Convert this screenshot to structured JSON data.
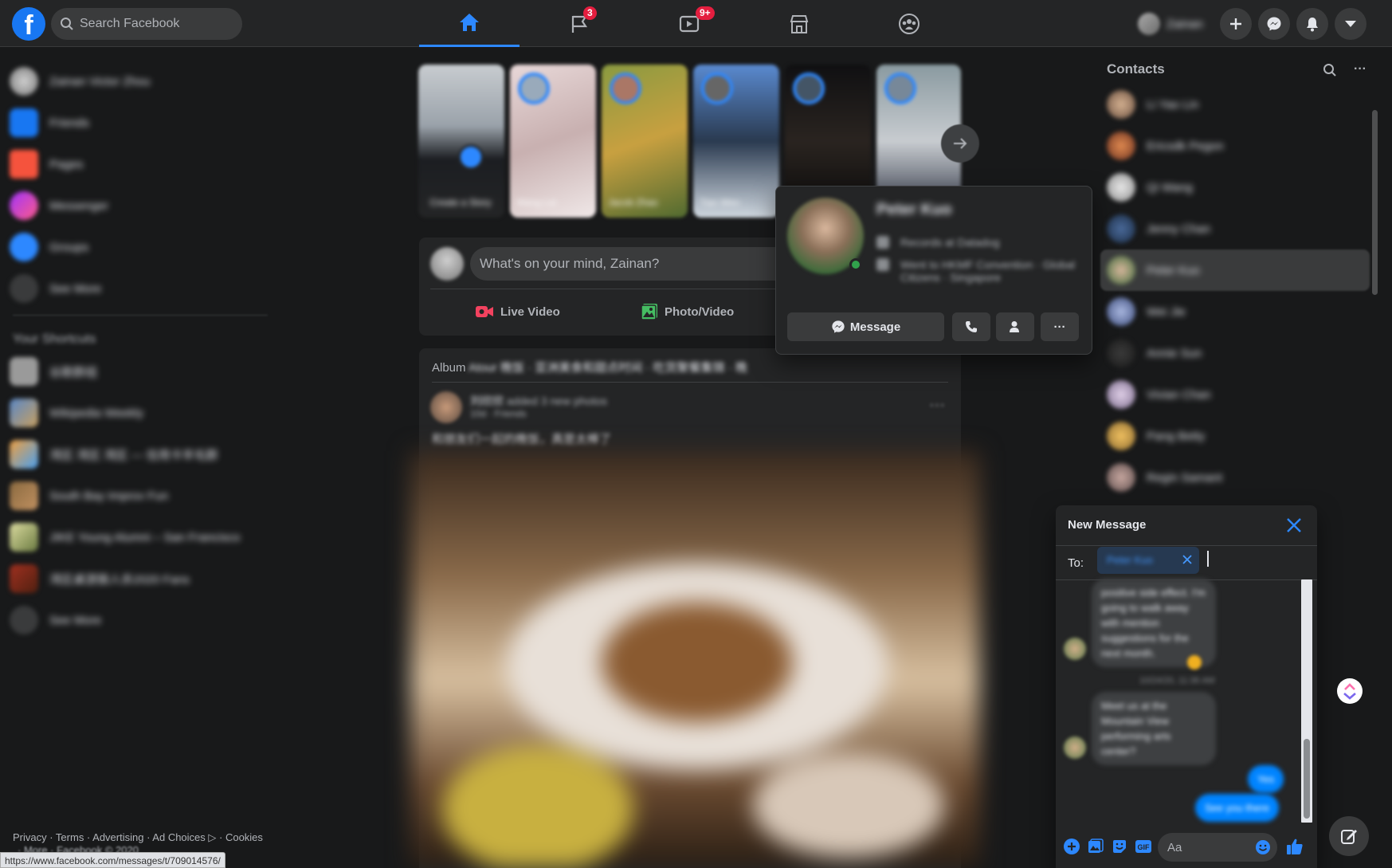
{
  "colors": {
    "accent": "#2d88ff",
    "badge": "#e41e3f",
    "online": "#31a24c",
    "live_video": "#f3425f",
    "photo": "#45bd62"
  },
  "search": {
    "placeholder": "Search Facebook"
  },
  "nav": {
    "tabs": [
      {
        "icon": "home-icon",
        "active": true
      },
      {
        "icon": "pages-flag-icon",
        "badge": "3"
      },
      {
        "icon": "watch-icon",
        "badge": "9+"
      },
      {
        "icon": "marketplace-icon"
      },
      {
        "icon": "groups-icon"
      }
    ]
  },
  "header": {
    "profile_name": "Zainan"
  },
  "left_menu": {
    "items": [
      {
        "label": "Zainan Victor Zhou"
      },
      {
        "label": "Friends"
      },
      {
        "label": "Pages"
      },
      {
        "label": "Messenger"
      },
      {
        "label": "Groups"
      },
      {
        "label": "See More"
      }
    ],
    "shortcuts_heading": "Your Shortcuts",
    "shortcuts": [
      {
        "label": "谷歌群组"
      },
      {
        "label": "Wikipedia Weekly"
      },
      {
        "label": "湾区 湾区 湾区 — 信用卡羊毛群"
      },
      {
        "label": "South Bay Improv Fun"
      },
      {
        "label": "JIKE Young Alumni – San Francisco"
      },
      {
        "label": "湾区桌游狼人杀2020 Fans"
      },
      {
        "label": "See More"
      }
    ]
  },
  "footer": {
    "links": "Privacy · Terms · Advertising · Ad Choices ▷ · Cookies",
    "line2": "· More · Facebook © 2020",
    "status_url": "https://www.facebook.com/messages/t/709014576/"
  },
  "stories": [
    {
      "caption": "Create a Story"
    },
    {
      "caption": "Wang Lei"
    },
    {
      "caption": "Jacob Zhao"
    },
    {
      "caption": "Tian Wen"
    },
    {
      "caption": ""
    },
    {
      "caption": ""
    }
  ],
  "composer": {
    "placeholder": "What's on your mind, Zainan?",
    "live_label": "Live Video",
    "photo_label": "Photo/Video"
  },
  "post": {
    "album_prefix": "Album ",
    "album_name": "Atour 晚饭 · 亚洲美食和甜点时间 · 吃货聚餐集锦 · 晚",
    "author": "刘欣欣",
    "author_action": "added 3 new photos",
    "meta": "10d · Friends",
    "text": "和朋友们一起的晚饭，真是太棒了",
    "more": "···"
  },
  "hovercard": {
    "name": "Peter Kuo",
    "line1": "Records at Datadog",
    "line2": "Went to HKMF Convention · Global Citizens · Singapore",
    "message_label": "Message",
    "more": "···"
  },
  "contacts": {
    "title": "Contacts",
    "items": [
      {
        "name": "Li Yao Lin"
      },
      {
        "name": "Ericsdk Pegon"
      },
      {
        "name": "Qi Wang"
      },
      {
        "name": "Jenny Chan"
      },
      {
        "name": "Peter Kuo"
      },
      {
        "name": "Wei Jie"
      },
      {
        "name": "Annie Sun"
      },
      {
        "name": "Vivian Chan"
      },
      {
        "name": "Pang Betty"
      },
      {
        "name": "Regin Samant"
      }
    ]
  },
  "new_message": {
    "title": "New Message",
    "to_label": "To:",
    "recipient": "Peter Kuo",
    "bubble1": "positive side effect. I'm going to walk away with mention suggestions for the next month.",
    "timestamp": "10/24/20, 11:36 AM",
    "bubble2": "Meet us at the Mountain View performing arts center?",
    "mine1": "Yes",
    "mine2": "See you there",
    "input_placeholder": "Aa"
  }
}
